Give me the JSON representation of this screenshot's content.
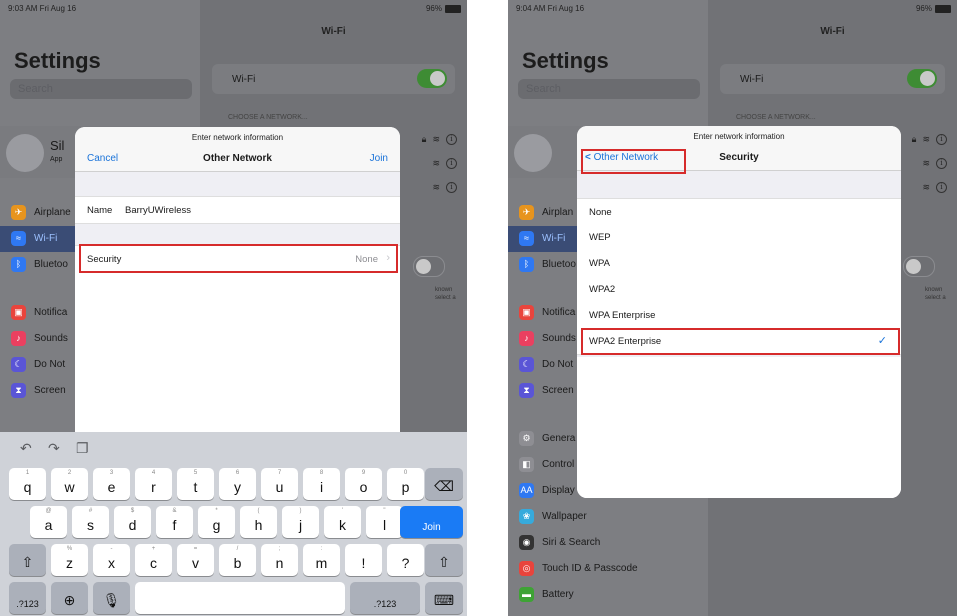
{
  "left": {
    "status": {
      "time": "9:03 AM  Fri Aug 16",
      "battery": "96%"
    },
    "settings_title": "Settings",
    "search_placeholder": "Search",
    "profile": {
      "name": "Sil",
      "sub": "App"
    },
    "sidebar_items": [
      {
        "label": "Airplane",
        "color": "#e7941d",
        "icon": "✈"
      },
      {
        "label": "Wi-Fi",
        "color": "#2f78f2",
        "icon": "≈"
      },
      {
        "label": "Bluetoo",
        "color": "#2f78f2",
        "icon": "ᛒ"
      },
      {
        "label": "Notifica",
        "color": "#e9443c",
        "icon": "▣"
      },
      {
        "label": "Sounds",
        "color": "#ea4060",
        "icon": "♪"
      },
      {
        "label": "Do Not",
        "color": "#5a55d6",
        "icon": "☾"
      },
      {
        "label": "Screen",
        "color": "#5a55d6",
        "icon": "⧗"
      }
    ],
    "wifi_title": "Wi-Fi",
    "wifi_label": "Wi-Fi",
    "choose_network": "CHOOSE A NETWORK...",
    "known_text": "known select a",
    "modal": {
      "prompt": "Enter network information",
      "title": "Other Network",
      "cancel": "Cancel",
      "join": "Join",
      "name_label": "Name",
      "name_value": "BarryUWireless",
      "security_label": "Security",
      "security_value": "None"
    },
    "keyboard": {
      "row1": [
        {
          "main": "q",
          "sub": "1"
        },
        {
          "main": "w",
          "sub": "2"
        },
        {
          "main": "e",
          "sub": "3"
        },
        {
          "main": "r",
          "sub": "4"
        },
        {
          "main": "t",
          "sub": "5"
        },
        {
          "main": "y",
          "sub": "6"
        },
        {
          "main": "u",
          "sub": "7"
        },
        {
          "main": "i",
          "sub": "8"
        },
        {
          "main": "o",
          "sub": "9"
        },
        {
          "main": "p",
          "sub": "0"
        }
      ],
      "row2": [
        {
          "main": "a",
          "sub": "@"
        },
        {
          "main": "s",
          "sub": "#"
        },
        {
          "main": "d",
          "sub": "$"
        },
        {
          "main": "f",
          "sub": "&"
        },
        {
          "main": "g",
          "sub": "*"
        },
        {
          "main": "h",
          "sub": "("
        },
        {
          "main": "j",
          "sub": ")"
        },
        {
          "main": "k",
          "sub": "'"
        },
        {
          "main": "l",
          "sub": "\""
        }
      ],
      "row3": [
        {
          "main": "z",
          "sub": "%"
        },
        {
          "main": "x",
          "sub": "-"
        },
        {
          "main": "c",
          "sub": "+"
        },
        {
          "main": "v",
          "sub": "="
        },
        {
          "main": "b",
          "sub": "/"
        },
        {
          "main": "n",
          "sub": ";"
        },
        {
          "main": "m",
          "sub": ":"
        },
        {
          "main": "!",
          "sub": ""
        },
        {
          "main": "?",
          "sub": ""
        }
      ],
      "join": "Join",
      "numbers": ".?123"
    }
  },
  "right": {
    "status": {
      "time": "9:04 AM  Fri Aug 16",
      "battery": "96%"
    },
    "settings_title": "Settings",
    "search_placeholder": "Search",
    "sidebar_items": [
      {
        "label": "Airplan",
        "color": "#e7941d",
        "icon": "✈"
      },
      {
        "label": "Wi-Fi",
        "color": "#2f78f2",
        "icon": "≈"
      },
      {
        "label": "Bluetoo",
        "color": "#2f78f2",
        "icon": "ᛒ"
      },
      {
        "label": "Notifica",
        "color": "#e9443c",
        "icon": "▣"
      },
      {
        "label": "Sounds",
        "color": "#ea4060",
        "icon": "♪"
      },
      {
        "label": "Do Not",
        "color": "#5a55d6",
        "icon": "☾"
      },
      {
        "label": "Screen",
        "color": "#5a55d6",
        "icon": "⧗"
      },
      {
        "label": "Genera",
        "color": "#8e8e93",
        "icon": "⚙"
      },
      {
        "label": "Control",
        "color": "#8e8e93",
        "icon": "◧"
      },
      {
        "label": "Display",
        "color": "#2f78f2",
        "icon": "AA"
      },
      {
        "label": "Wallpaper",
        "color": "#36aadc",
        "icon": "❀"
      },
      {
        "label": "Siri & Search",
        "color": "#333333",
        "icon": "◉"
      },
      {
        "label": "Touch ID & Passcode",
        "color": "#e9443c",
        "icon": "◎"
      },
      {
        "label": "Battery",
        "color": "#3ea335",
        "icon": "▬"
      }
    ],
    "wifi_title": "Wi-Fi",
    "wifi_label": "Wi-Fi",
    "choose_network": "CHOOSE A NETWORK...",
    "known_text": "known select a",
    "modal": {
      "prompt": "Enter network information",
      "back": "Other Network",
      "title": "Security",
      "options": [
        "None",
        "WEP",
        "WPA",
        "WPA2",
        "WPA Enterprise",
        "WPA2 Enterprise"
      ],
      "selected": "WPA2 Enterprise"
    }
  }
}
